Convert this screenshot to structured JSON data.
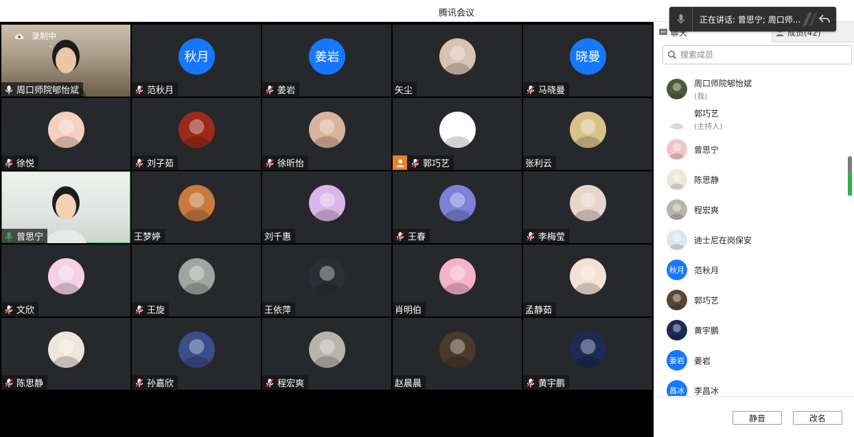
{
  "window": {
    "title": "腾讯会议"
  },
  "speaking": {
    "text": "正在讲话: 曾思宁; 周口师..."
  },
  "recording": {
    "label": "录制中"
  },
  "tiles": [
    {
      "name": "周口师院郇怡斌",
      "mic": "white",
      "kind": "video1"
    },
    {
      "name": "范秋月",
      "mic": "muted",
      "kind": "text",
      "avatar_text": "秋月"
    },
    {
      "name": "姜岩",
      "mic": "muted",
      "kind": "text",
      "avatar_text": "姜岩"
    },
    {
      "name": "矢尘",
      "mic": "none",
      "kind": "img",
      "color": "#d8c2b1"
    },
    {
      "name": "马晓曼",
      "mic": "muted",
      "kind": "text",
      "avatar_text": "晓曼"
    },
    {
      "name": "徐悦",
      "mic": "muted",
      "kind": "img",
      "color": "#f5d0c0"
    },
    {
      "name": "刘子茹",
      "mic": "muted",
      "kind": "img",
      "color": "#9b2a1c"
    },
    {
      "name": "徐昕怡",
      "mic": "muted",
      "kind": "img",
      "color": "#d9b39c"
    },
    {
      "name": "郭巧艺",
      "mic": "muted",
      "kind": "img",
      "color": "#ffffff",
      "host": true
    },
    {
      "name": "张利云",
      "mic": "none",
      "kind": "img",
      "color": "#d7c38a"
    },
    {
      "name": "曾思宁",
      "mic": "green",
      "kind": "video2"
    },
    {
      "name": "王梦婷",
      "mic": "none",
      "kind": "img",
      "color": "#c77a3c"
    },
    {
      "name": "刘千惠",
      "mic": "none",
      "kind": "img",
      "color": "#d9b5e8"
    },
    {
      "name": "王春",
      "mic": "muted",
      "kind": "img",
      "color": "#7b82d8"
    },
    {
      "name": "李梅莹",
      "mic": "muted",
      "kind": "img",
      "color": "#e8d5cc"
    },
    {
      "name": "文欣",
      "mic": "muted",
      "kind": "img",
      "color": "#f4d2e4"
    },
    {
      "name": "王旋",
      "mic": "muted",
      "kind": "img",
      "color": "#a0a5a0"
    },
    {
      "name": "王依萍",
      "mic": "none",
      "kind": "img",
      "color": "#2b2f34"
    },
    {
      "name": "肖明伯",
      "mic": "none",
      "kind": "img",
      "color": "#f3b4c8"
    },
    {
      "name": "孟静茹",
      "mic": "none",
      "kind": "img",
      "color": "#f3e1d3"
    },
    {
      "name": "陈思静",
      "mic": "muted",
      "kind": "img",
      "color": "#efe6db"
    },
    {
      "name": "孙嘉欣",
      "mic": "muted",
      "kind": "img",
      "color": "#3b4e8c"
    },
    {
      "name": "程宏爽",
      "mic": "muted",
      "kind": "img",
      "color": "#b7b3ad"
    },
    {
      "name": "赵晨晨",
      "mic": "none",
      "kind": "img",
      "color": "#4a3a2a"
    },
    {
      "name": "黄宇鹏",
      "mic": "muted",
      "kind": "img",
      "color": "#1c2a55"
    }
  ],
  "panel": {
    "tab_chat": "聊天",
    "tab_members": "成员(42)",
    "search_placeholder": "搜索成员",
    "members": [
      {
        "name": "周口师院郇怡斌",
        "tag": "(我)",
        "kind": "img",
        "color": "#4d5a3a"
      },
      {
        "name": "郭巧艺",
        "tag": "(主持人)",
        "kind": "img",
        "color": "#ffffff"
      },
      {
        "name": "曾思宁",
        "tag": "",
        "kind": "img",
        "color": "#f0c6c6"
      },
      {
        "name": "陈思静",
        "tag": "",
        "kind": "img",
        "color": "#efe6db"
      },
      {
        "name": "程宏爽",
        "tag": "",
        "kind": "img",
        "color": "#b7b3ad"
      },
      {
        "name": "迪士尼在岗保安",
        "tag": "",
        "kind": "img",
        "color": "#dfe6ee"
      },
      {
        "name": "范秋月",
        "tag": "",
        "kind": "text",
        "avatar_text": "秋月"
      },
      {
        "name": "郭巧艺",
        "tag": "",
        "kind": "img",
        "color": "#5a4632"
      },
      {
        "name": "黄宇鹏",
        "tag": "",
        "kind": "img",
        "color": "#1c2a55"
      },
      {
        "name": "姜岩",
        "tag": "",
        "kind": "text",
        "avatar_text": "姜岩"
      },
      {
        "name": "李昌冰",
        "tag": "",
        "kind": "text",
        "avatar_text": "昌冰"
      }
    ],
    "mute_label": "静音",
    "rename_label": "改名"
  },
  "colors": {
    "accent": "#1677ff",
    "speaking_green": "#2fb24f",
    "muted_red": "#e0343a",
    "host_orange": "#f07f22"
  }
}
